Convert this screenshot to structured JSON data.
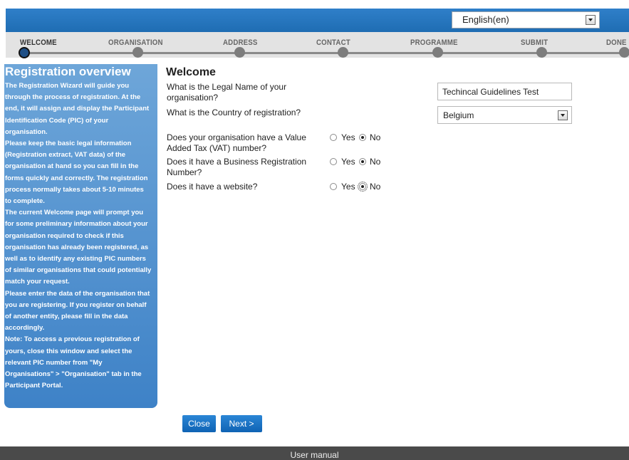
{
  "language": {
    "selected": "English(en)"
  },
  "steps": [
    "WELCOME",
    "ORGANISATION",
    "ADDRESS",
    "CONTACT",
    "PROGRAMME",
    "SUBMIT",
    "DONE"
  ],
  "overview": {
    "title": "Registration overview",
    "lines": [
      "The Registration Wizard will guide you",
      "through the process of registration. At the",
      "end, it will assign and display the Participant",
      "Identification Code (PIC) of your",
      "organisation.",
      "Please keep the basic legal information",
      "(Registration extract, VAT data) of the",
      "organisation at hand so you can fill in the",
      "forms quickly and correctly. The registration",
      "process normally takes about 5-10 minutes",
      "to complete.",
      "The current Welcome page will prompt you",
      "for some preliminary information about your",
      "organisation required to check if this",
      "organisation has already been registered, as",
      "well as to identify any existing PIC numbers",
      "of similar organisations that could potentially",
      "match your request.",
      "Please enter the data of the organisation that",
      "you are registering. If you register on behalf",
      "of another entity, please fill in the data",
      "accordingly.",
      "Note: To access a previous registration of",
      "yours, close this window and select the",
      "relevant PIC number from \"My",
      "Organisations\" > \"Organisation\" tab in the",
      "Participant Portal."
    ]
  },
  "main": {
    "title": "Welcome",
    "legal_name_question": "What is the Legal Name of your organisation?",
    "legal_name_value": "Techincal Guidelines Test",
    "country_question": "What is the Country of registration?",
    "country_value": "Belgium",
    "vat_question": "Does your organisation have a Value Added Tax (VAT) number?",
    "brn_question": "Does it have a Business Registration Number?",
    "website_question": "Does it have a website?",
    "yes_label": "Yes",
    "no_label": "No"
  },
  "buttons": {
    "close": "Close",
    "next": "Next >"
  },
  "footer": {
    "user_manual": "User manual"
  },
  "colors": {
    "accent": "#1f6db3",
    "overview_panel": "#4a8bcb",
    "footer": "#4a4a4a"
  }
}
